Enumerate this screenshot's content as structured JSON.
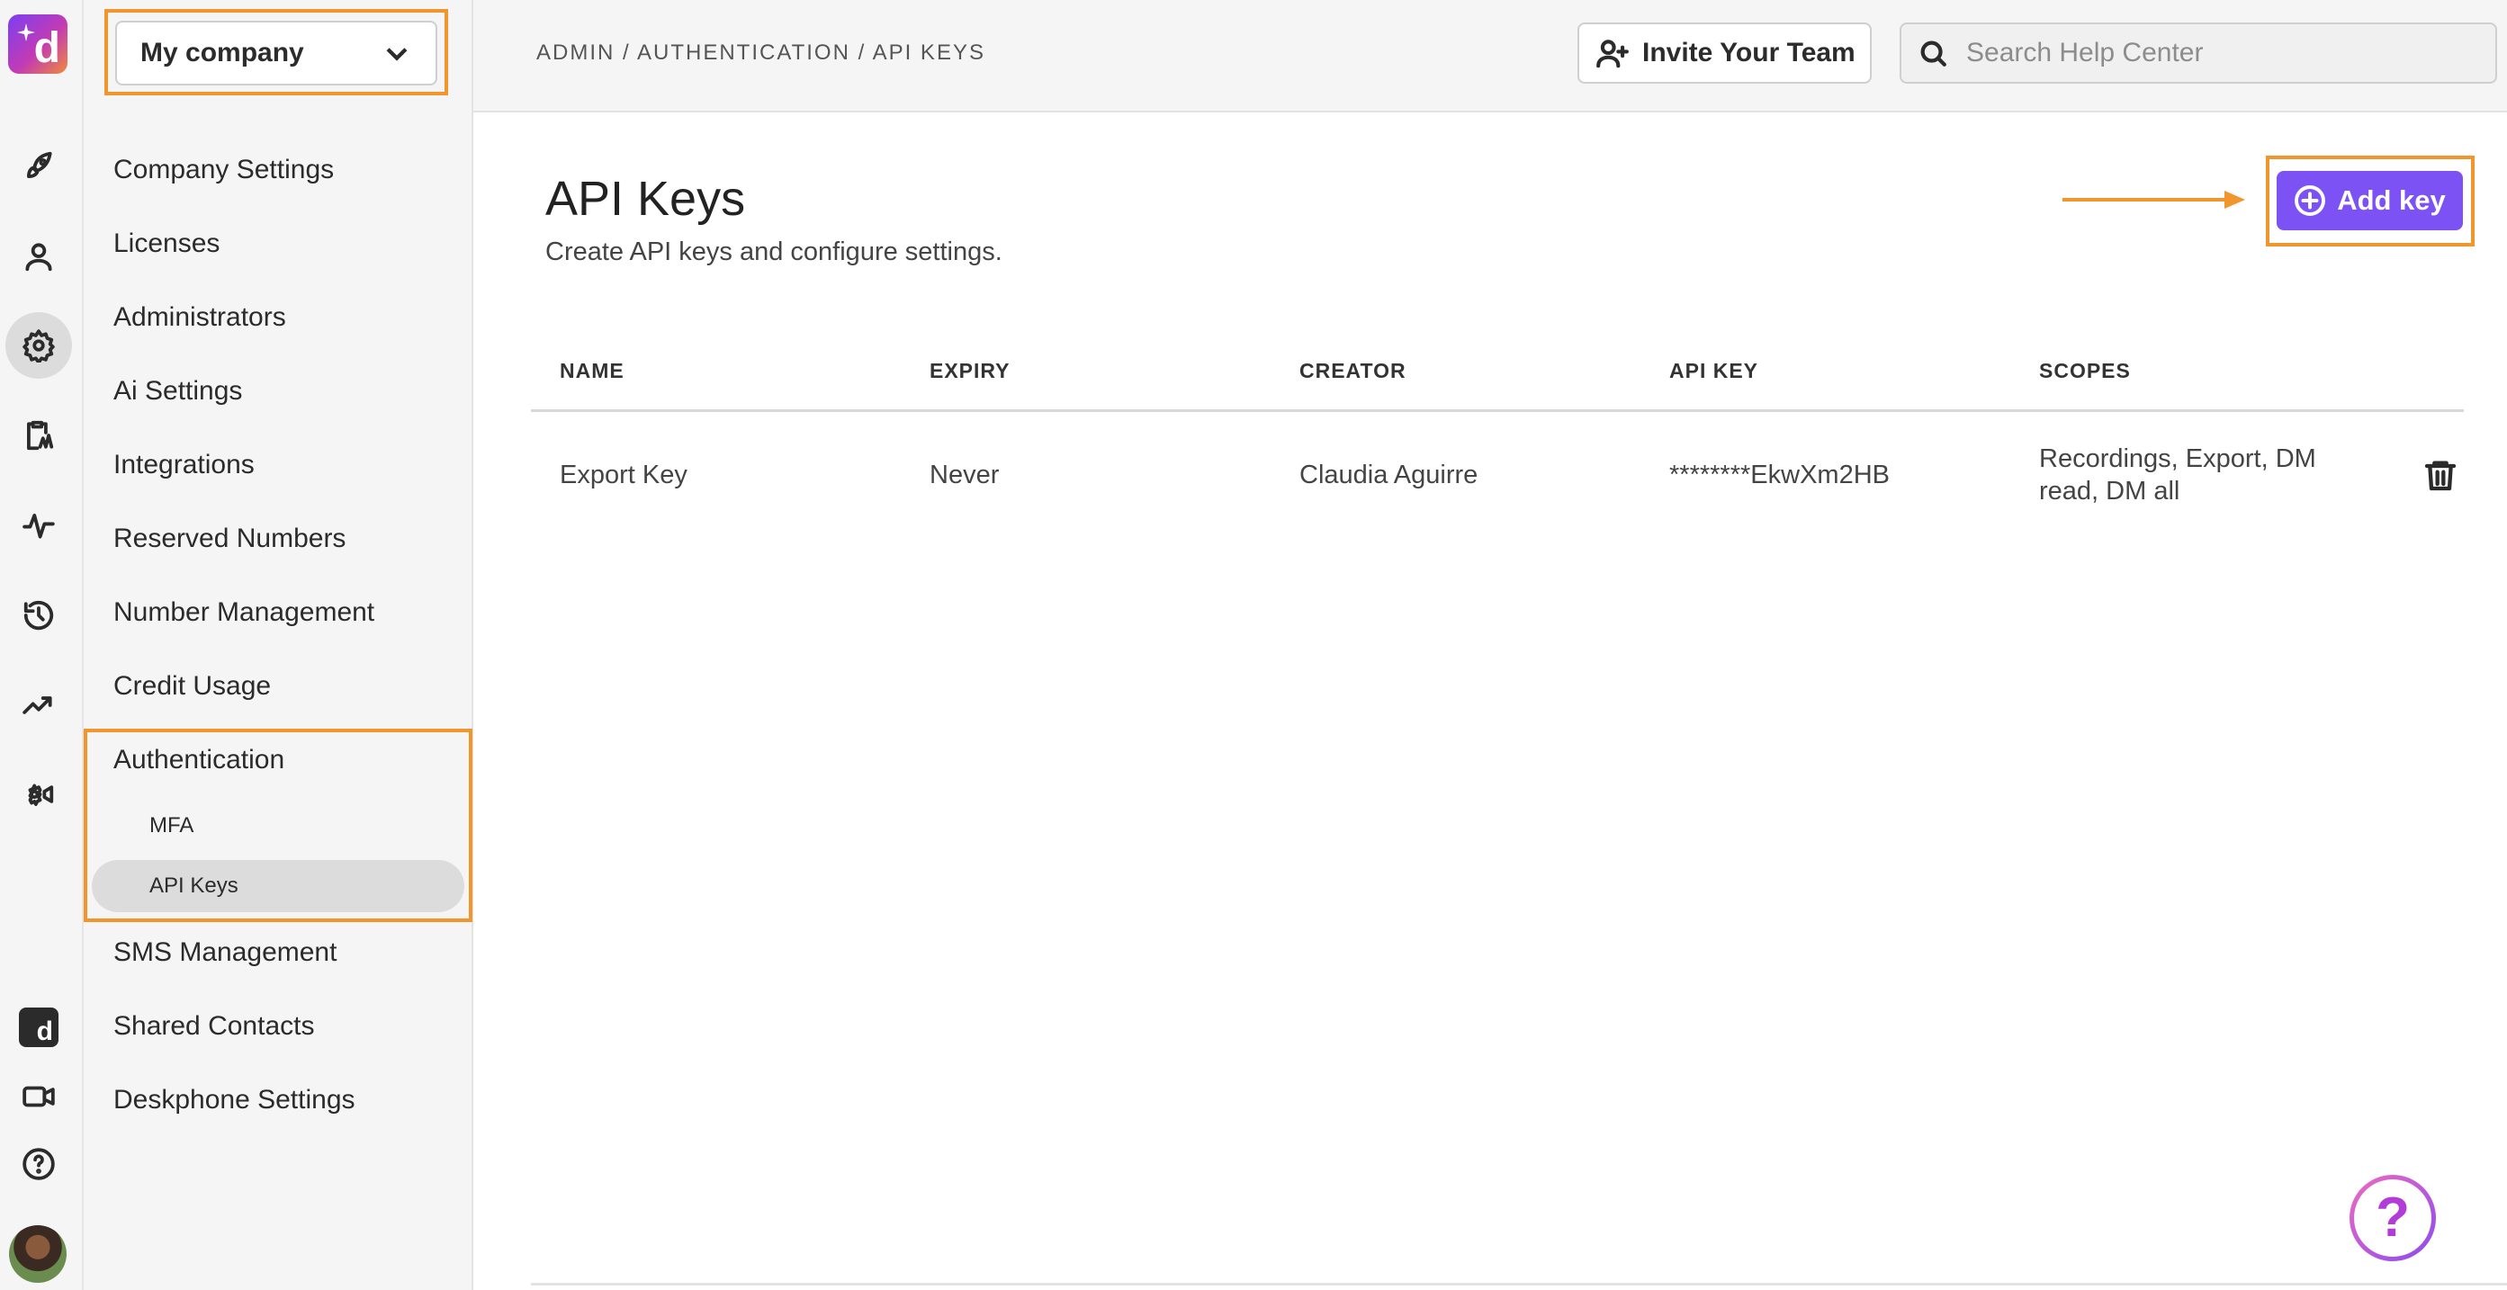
{
  "company": {
    "selected": "My company"
  },
  "sidebar": {
    "items": [
      {
        "label": "Company Settings"
      },
      {
        "label": "Licenses"
      },
      {
        "label": "Administrators"
      },
      {
        "label": "Ai Settings"
      },
      {
        "label": "Integrations"
      },
      {
        "label": "Reserved Numbers"
      },
      {
        "label": "Number Management"
      },
      {
        "label": "Credit Usage"
      },
      {
        "label": "Authentication"
      },
      {
        "label": "SMS Management"
      },
      {
        "label": "Shared Contacts"
      },
      {
        "label": "Deskphone Settings"
      }
    ],
    "auth_sub": [
      {
        "label": "MFA"
      },
      {
        "label": "API Keys"
      }
    ]
  },
  "rail": {
    "icons": [
      "rocket-icon",
      "person-icon",
      "gear-icon",
      "clipboard-icon",
      "activity-icon",
      "history-icon",
      "trending-icon",
      "settings-video-icon",
      "brand-icon",
      "video-icon",
      "help-icon"
    ]
  },
  "header": {
    "breadcrumb": "ADMIN / AUTHENTICATION / API KEYS",
    "invite_label": "Invite Your Team",
    "search_placeholder": "Search Help Center"
  },
  "main": {
    "title": "API Keys",
    "subtitle": "Create API keys and configure settings.",
    "add_label": "Add key",
    "columns": [
      "NAME",
      "EXPIRY",
      "CREATOR",
      "API KEY",
      "SCOPES"
    ],
    "rows": [
      {
        "name": "Export Key",
        "expiry": "Never",
        "creator": "Claudia Aguirre",
        "api_key": "********EkwXm2HB",
        "scopes_line1": "Recordings, Export, DM",
        "scopes_line2": "read, DM all"
      }
    ]
  },
  "colors": {
    "accent": "#7c52f5",
    "highlight": "#f0962c"
  },
  "help_fab": {
    "glyph": "?"
  }
}
